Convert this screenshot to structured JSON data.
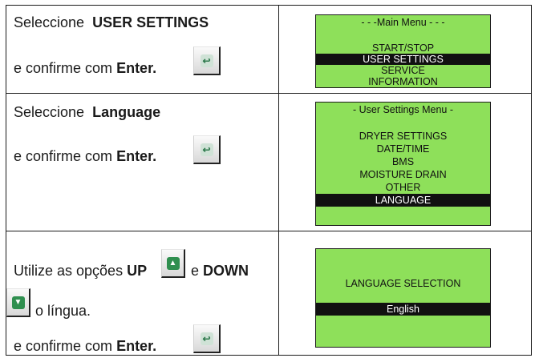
{
  "rows": [
    {
      "select_prefix": "Seleccione",
      "select_item": "USER SETTINGS",
      "confirm_prefix": "e confirme com",
      "confirm_key": "Enter.",
      "screen": {
        "title": "- - -Main Menu - - -",
        "items": [
          "START/STOP",
          "USER SETTINGS",
          "SERVICE",
          "INFORMATION"
        ],
        "selected": "USER SETTINGS"
      }
    },
    {
      "select_prefix": "Seleccione",
      "select_item": "Language",
      "confirm_prefix": "e confirme com",
      "confirm_key": "Enter.",
      "screen": {
        "title": "- User Settings Menu -",
        "items": [
          "DRYER SETTINGS",
          "DATE/TIME",
          "BMS",
          "MOISTURE DRAIN",
          "OTHER",
          "LANGUAGE"
        ],
        "selected": "LANGUAGE"
      }
    },
    {
      "use_prefix": "Utilize as opções",
      "up_label": "UP",
      "and_word": "e",
      "down_label": "DOWN",
      "after_down": "o língua.",
      "confirm_prefix": "e confirme com",
      "confirm_key": "Enter.",
      "screen": {
        "title": "LANGUAGE SELECTION",
        "value": "English"
      }
    }
  ],
  "icons": {
    "enter": "enter-arrow-icon",
    "up": "arrow-up-icon",
    "down": "arrow-down-icon"
  },
  "colors": {
    "lcd_background": "#8ee05a",
    "lcd_selection": "#111111",
    "table_border": "#1a1a1a"
  }
}
